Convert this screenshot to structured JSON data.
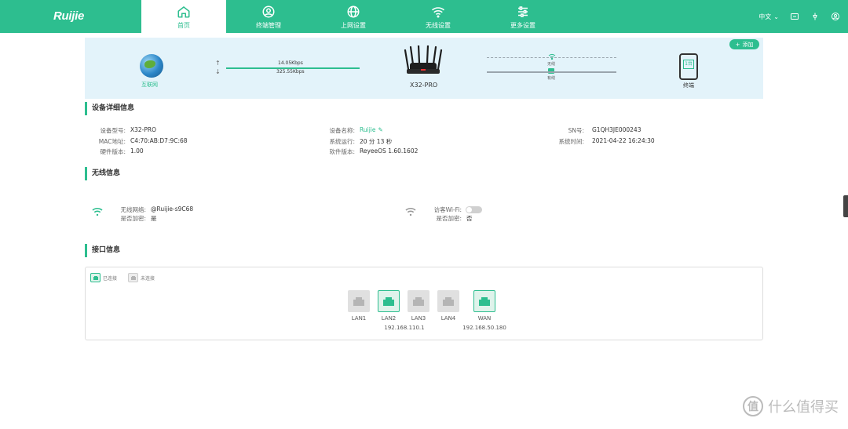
{
  "header": {
    "logo": "Ruijie",
    "nav": [
      {
        "label": "首页",
        "icon": "home-icon"
      },
      {
        "label": "终端管理",
        "icon": "user-circle-icon"
      },
      {
        "label": "上网设置",
        "icon": "globe-icon"
      },
      {
        "label": "无线设置",
        "icon": "wifi-icon"
      },
      {
        "label": "更多设置",
        "icon": "sliders-icon"
      }
    ],
    "active_index": 0,
    "language": "中文",
    "right_icons": [
      "screen-icon",
      "tools-icon",
      "user-icon"
    ]
  },
  "topology": {
    "internet_label": "互联网",
    "upload_speed": "14.05Kbps",
    "download_speed": "325.55Kbps",
    "router_label": "X32-PRO",
    "wireless_label": "无线",
    "wired_label": "有线",
    "terminal_label": "终端",
    "terminal_count": "1台",
    "add_button": "添加"
  },
  "device_info": {
    "title": "设备详细信息",
    "model_key": "设备型号:",
    "model_val": "X32-PRO",
    "mac_key": "MAC地址:",
    "mac_val": "C4:70:AB:D7:9C:68",
    "hw_key": "硬件版本:",
    "hw_val": "1.00",
    "name_key": "设备名称:",
    "name_val": "Ruijie",
    "uptime_key": "系统运行:",
    "uptime_val": "20 分 13 秒",
    "sw_key": "软件版本:",
    "sw_val": "ReyeeOS 1.60.1602",
    "sn_key": "SN号:",
    "sn_val": "G1QH3JE000243",
    "time_key": "系统时间:",
    "time_val": "2021-04-22 16:24:30"
  },
  "wireless_info": {
    "title": "无线信息",
    "ssid_key": "无线网络:",
    "ssid_val": "@Ruijie-s9C68",
    "enc_key": "是否加密:",
    "enc_val": "是",
    "guest_key": "访客Wi-Fi:",
    "guest_enabled": false,
    "guest_enc_key": "是否加密:",
    "guest_enc_val": "否"
  },
  "port_info": {
    "title": "接口信息",
    "legend_connected": "已连接",
    "legend_disconnected": "未连接",
    "ports": [
      {
        "name": "LAN1",
        "connected": false,
        "ip": ""
      },
      {
        "name": "LAN2",
        "connected": true,
        "ip": "192.168.110.1"
      },
      {
        "name": "LAN3",
        "connected": false,
        "ip": ""
      },
      {
        "name": "LAN4",
        "connected": false,
        "ip": ""
      },
      {
        "name": "WAN",
        "connected": true,
        "ip": "192.168.50.180"
      }
    ]
  },
  "watermark": {
    "badge": "值",
    "text": "什么值得买"
  },
  "colors": {
    "accent": "#2dbe8f",
    "topo_bg": "#e3f3fa"
  }
}
